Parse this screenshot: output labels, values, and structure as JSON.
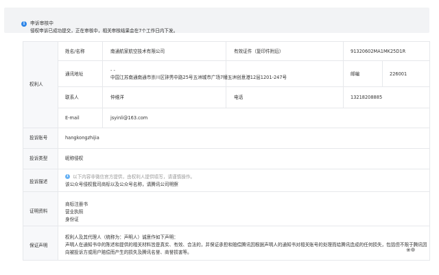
{
  "notice": {
    "icon": "info-icon",
    "title": "申诉审核中",
    "desc": "侵权申诉已成功提交，正在审核中，相关审核结果会在7个工作日内下发。"
  },
  "rights_holder": {
    "section_label": "权利人",
    "name_label": "姓名/名称",
    "name_value": "南通航家航空技术有限公司",
    "cert_label": "有效证件（复印件附后）",
    "cert_value": "91320602MA1MK25D1R",
    "address_label": "通讯地址",
    "address_line1": "- -",
    "address_line2": "中国江苏南通南通市崇川区钟秀中路25号五洲城市广场7幢五洲创意港12层1201-247号",
    "postcode_label": "邮编",
    "postcode_value": "226001",
    "contact_label": "联系人",
    "contact_value": "仲维洋",
    "phone_label": "电话",
    "phone_value": "13218208885",
    "email_label": "E-mail",
    "email_value": "jsyinli@163.com"
  },
  "complaint_account": {
    "label": "投诉账号",
    "value": "hangkongzhijia"
  },
  "complaint_type": {
    "label": "投诉类型",
    "value": "昵称侵权"
  },
  "complaint_desc": {
    "label": "投诉描述",
    "tip": "以下内容非微信官方提供，由权利人提供填写，请谨慎操作。",
    "value": "该公众号侵权我司商标以及公众号名称，请腾讯公司明察"
  },
  "evidence": {
    "label": "证明资料",
    "items": [
      "商标注册书",
      "营业执照",
      "身份证"
    ]
  },
  "declaration": {
    "label": "保证声明",
    "line1": "权利人及其代理人（统称为：声明人）诚意作如下声明：",
    "line2": "声明人在通知书中的陈述和提供的相关材料皆是真实、有效、合法的，并保证承担和赔偿腾讯因根据声明人的通知书对相关账号的处理而给腾讯造成的任何损失，包括但不限于腾讯因",
    "line3": "向被投诉方或用户赔偿而产生的损失及腾讯名誉、商誉损害等。"
  },
  "watermark": "❀❁"
}
